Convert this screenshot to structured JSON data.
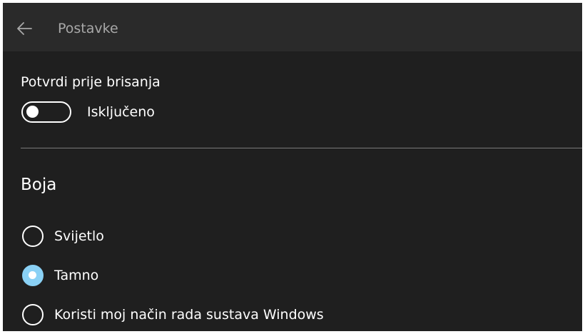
{
  "header": {
    "back_icon": "arrow-left-icon",
    "title": "Postavke"
  },
  "confirm_delete": {
    "label": "Potvrdi prije brisanja",
    "toggle_state": "Isključeno",
    "is_on": false
  },
  "color_section": {
    "heading": "Boja",
    "options": [
      {
        "label": "Svijetlo",
        "selected": false
      },
      {
        "label": "Tamno",
        "selected": true
      },
      {
        "label": "Koristi moj način rada sustava Windows",
        "selected": false
      }
    ]
  },
  "colors": {
    "background": "#1f1f1f",
    "titlebar": "#2a2a2a",
    "accent": "#8ad1f5",
    "title_text": "#a8a8a8",
    "divider": "#7a7a7a"
  }
}
